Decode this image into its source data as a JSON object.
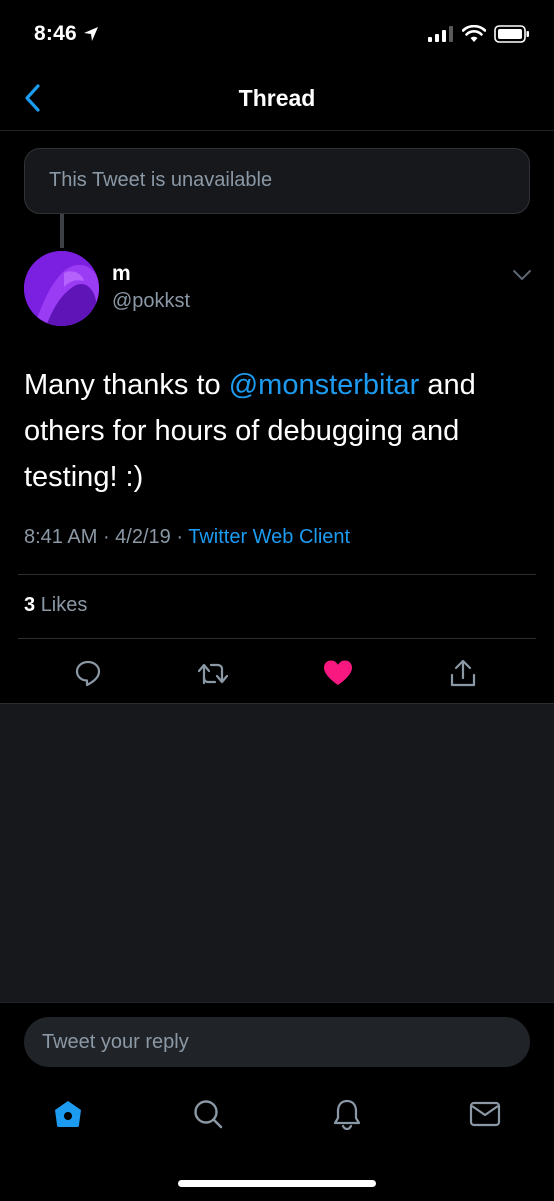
{
  "status_bar": {
    "time": "8:46"
  },
  "nav": {
    "title": "Thread"
  },
  "unavailable_tweet": {
    "text": "This Tweet is unavailable"
  },
  "tweet": {
    "display_name": "m",
    "handle": "@pokkst",
    "text_before": "Many thanks to ",
    "mention": "@monsterbitar",
    "text_after": " and others for hours of debugging and testing! :)",
    "time": "8:41 AM",
    "separator1": " · ",
    "date": "4/2/19",
    "separator2": " · ",
    "source": "Twitter Web Client",
    "likes_count": "3",
    "likes_label": "Likes"
  },
  "actions": {
    "reply_icon": "reply-icon",
    "retweet_icon": "retweet-icon",
    "like_icon": "heart-icon",
    "share_icon": "share-icon",
    "liked": true
  },
  "reply_box": {
    "placeholder": "Tweet your reply"
  },
  "tab_bar": {
    "items": [
      "home-icon",
      "search-icon",
      "notifications-icon",
      "messages-icon"
    ],
    "active": "home-icon"
  },
  "colors": {
    "accent": "#1d9bf0",
    "like": "#f91880",
    "background": "#000000",
    "secondary_text": "#8b98a5"
  }
}
